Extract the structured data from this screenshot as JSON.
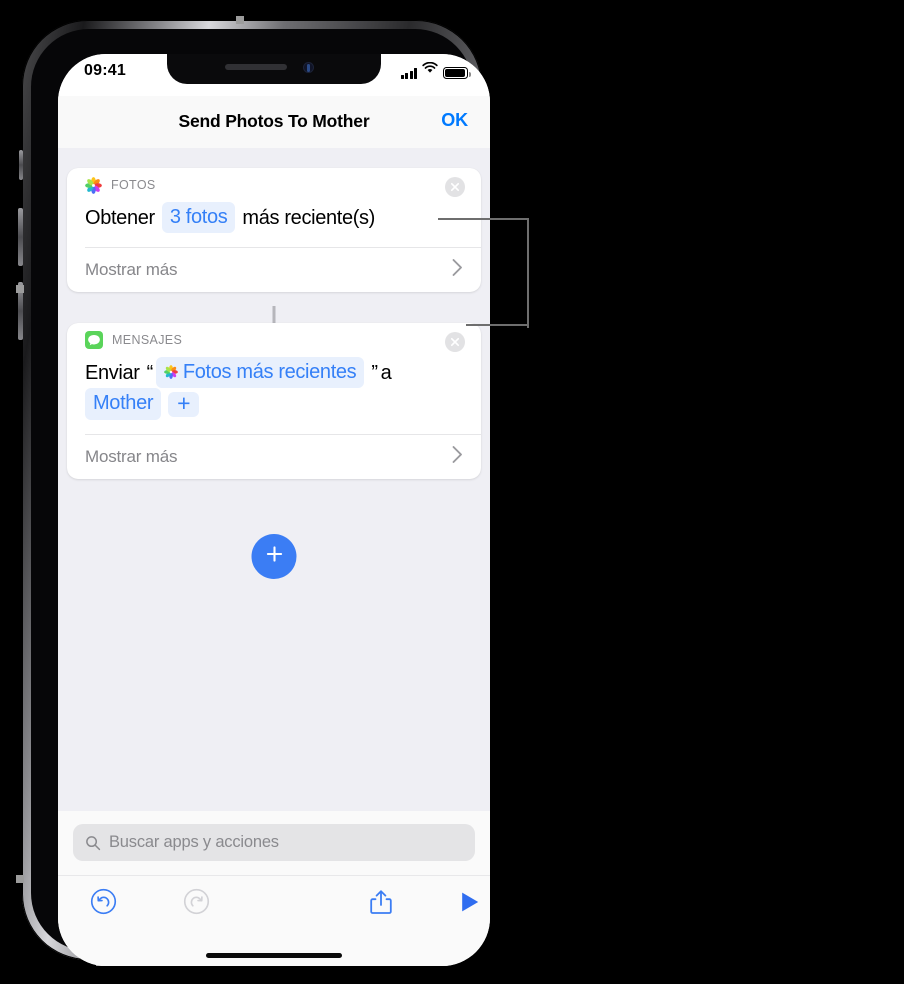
{
  "status_bar": {
    "time": "09:41",
    "signal_icon": "cellular-signal-icon",
    "wifi_icon": "wifi-icon",
    "battery_icon": "battery-icon"
  },
  "nav_bar": {
    "title": "Send Photos To Mother",
    "done_label": "OK"
  },
  "cards": [
    {
      "app_label": "FOTOS",
      "app_icon": "photos-app-icon",
      "close_icon": "close-circle-icon",
      "line": [
        {
          "type": "text",
          "value": "Obtener"
        },
        {
          "type": "token",
          "value": "3 fotos"
        },
        {
          "type": "text",
          "value": "más reciente(s)"
        }
      ],
      "show_more_label": "Mostrar más",
      "chevron_icon": "chevron-right-icon"
    },
    {
      "app_label": "MENSAJES",
      "app_icon": "messages-app-icon",
      "close_icon": "close-circle-icon",
      "line": [
        {
          "type": "text",
          "value": "Enviar"
        },
        {
          "type": "text",
          "value": "“"
        },
        {
          "type": "token-icon",
          "value": "Fotos más recientes",
          "icon": "photos-app-icon"
        },
        {
          "type": "text",
          "value": "”"
        },
        {
          "type": "text",
          "value": "a"
        },
        {
          "type": "token",
          "value": "Mother"
        },
        {
          "type": "token",
          "value": "+"
        }
      ],
      "show_more_label": "Mostrar más",
      "chevron_icon": "chevron-right-icon"
    }
  ],
  "add_button": {
    "icon": "plus-icon",
    "color": "#3b7df4"
  },
  "search": {
    "placeholder": "Buscar apps y acciones",
    "value": "",
    "icon": "search-icon"
  },
  "toolbar": {
    "undo": {
      "icon": "undo-icon",
      "enabled": true,
      "color": "#3b7df4"
    },
    "redo": {
      "icon": "redo-icon",
      "enabled": false,
      "color": "#c8c8cc"
    },
    "share": {
      "icon": "share-icon",
      "enabled": true,
      "color": "#3b7df4"
    },
    "run": {
      "icon": "play-icon",
      "enabled": true,
      "color": "#2f6df0"
    }
  },
  "colors": {
    "accent_blue": "#007aff",
    "token_blue": "#3580f7",
    "token_background": "#e8f0fd",
    "canvas_background": "#efeff4",
    "card_background": "#ffffff",
    "muted_text": "#8a8a8e"
  },
  "callouts": [
    {
      "label": "callout-line-photos-action"
    },
    {
      "label": "callout-line-messages-action"
    }
  ]
}
